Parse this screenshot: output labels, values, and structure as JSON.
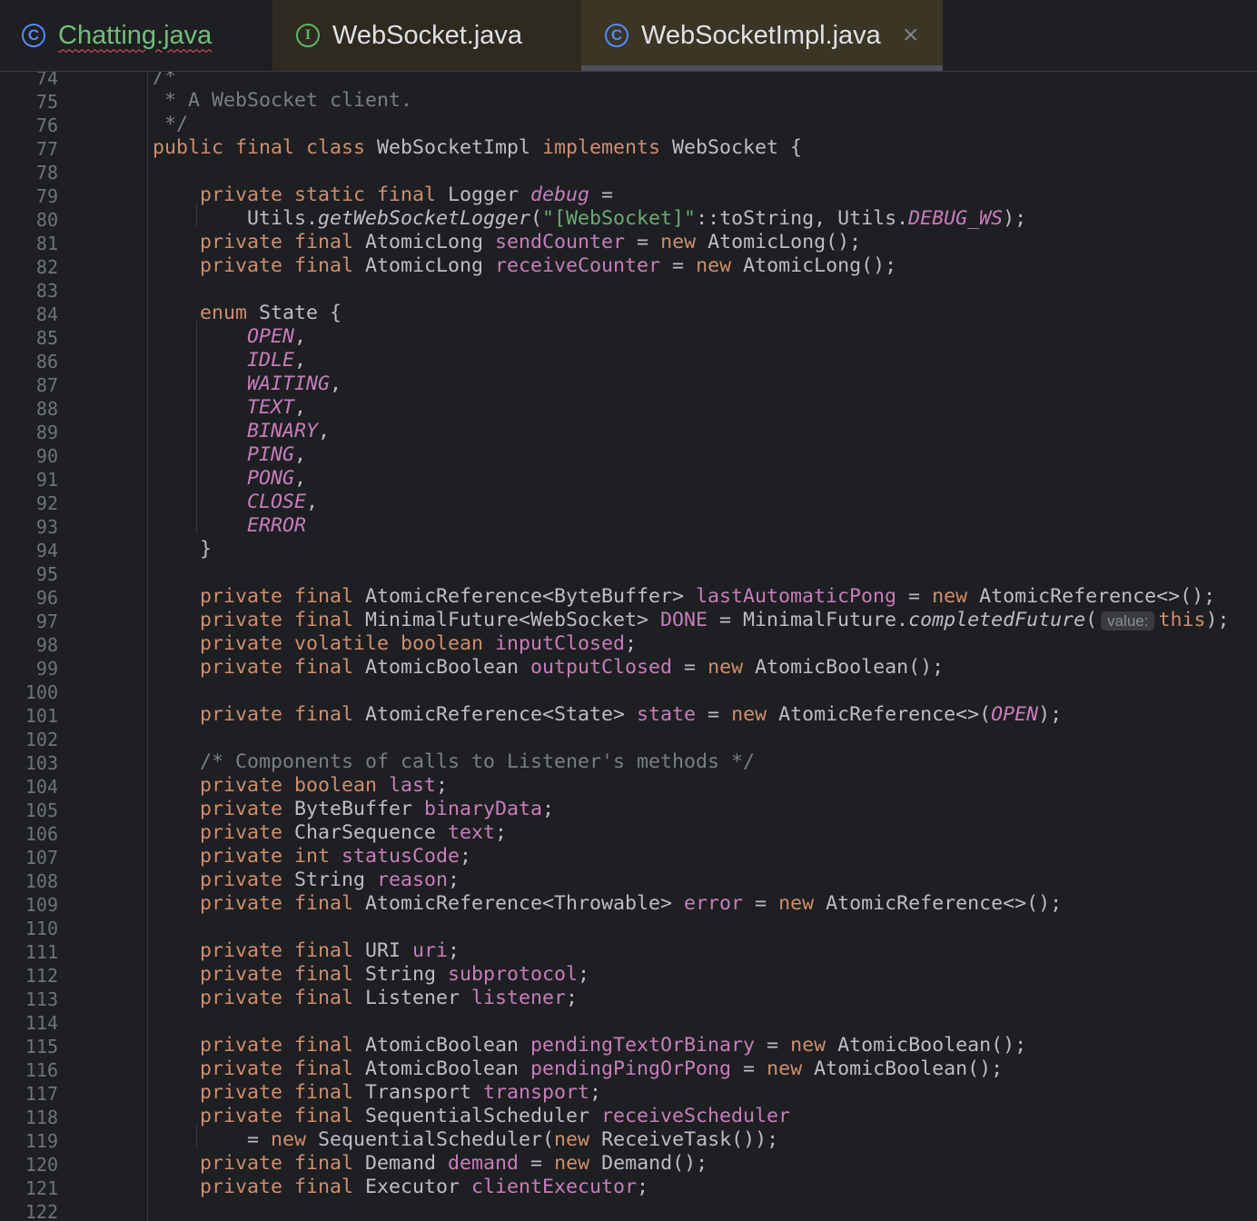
{
  "tabs": [
    {
      "label": "Chatting.java",
      "icon": "class-icon"
    },
    {
      "label": "WebSocket.java",
      "icon": "interface-icon"
    },
    {
      "label": "WebSocketImpl.java",
      "icon": "class-icon",
      "active": true,
      "close": "×"
    }
  ],
  "colors": {
    "background": "#1e1f22",
    "keyword": "#cf8e6d",
    "field": "#c77dbb",
    "string": "#6aab73",
    "comment": "#7a7e85",
    "text": "#bcbec4",
    "line_number": "#6f737a"
  },
  "editor": {
    "lines": [
      {
        "n": "74",
        "t": [
          [
            "/*",
            "cm"
          ]
        ]
      },
      {
        "n": "75",
        "t": [
          [
            " * A WebSocket client.",
            "cm"
          ]
        ]
      },
      {
        "n": "76",
        "t": [
          [
            " */",
            "cm"
          ]
        ]
      },
      {
        "n": "77",
        "t": [
          [
            "public final class ",
            "kw"
          ],
          [
            "WebSocketImpl ",
            ""
          ],
          [
            "implements ",
            "kw"
          ],
          [
            "WebSocket {",
            ""
          ]
        ]
      },
      {
        "n": "78",
        "t": []
      },
      {
        "n": "79",
        "t": [
          [
            "    private static final ",
            "kw"
          ],
          [
            "Logger ",
            ""
          ],
          [
            "debug",
            "st"
          ],
          [
            " =",
            ""
          ]
        ]
      },
      {
        "n": "80",
        "t": [
          [
            "        Utils.",
            ""
          ],
          [
            "getWebSocketLogger",
            "it"
          ],
          [
            "(",
            ""
          ],
          [
            "\"[WebSocket]\"",
            "str"
          ],
          [
            "::toString, Utils.",
            ""
          ],
          [
            "DEBUG_WS",
            "st"
          ],
          [
            ");",
            ""
          ]
        ]
      },
      {
        "n": "81",
        "t": [
          [
            "    private final ",
            "kw"
          ],
          [
            "AtomicLong ",
            ""
          ],
          [
            "sendCounter",
            "fld"
          ],
          [
            " = ",
            ""
          ],
          [
            "new ",
            "kw"
          ],
          [
            "AtomicLong();",
            ""
          ]
        ]
      },
      {
        "n": "82",
        "t": [
          [
            "    private final ",
            "kw"
          ],
          [
            "AtomicLong ",
            ""
          ],
          [
            "receiveCounter",
            "fld"
          ],
          [
            " = ",
            ""
          ],
          [
            "new ",
            "kw"
          ],
          [
            "AtomicLong();",
            ""
          ]
        ]
      },
      {
        "n": "83",
        "t": []
      },
      {
        "n": "84",
        "t": [
          [
            "    enum ",
            "kw"
          ],
          [
            "State {",
            ""
          ]
        ]
      },
      {
        "n": "85",
        "t": [
          [
            "        ",
            ""
          ],
          [
            "OPEN",
            "st"
          ],
          [
            ",",
            ""
          ]
        ]
      },
      {
        "n": "86",
        "t": [
          [
            "        ",
            ""
          ],
          [
            "IDLE",
            "st"
          ],
          [
            ",",
            ""
          ]
        ]
      },
      {
        "n": "87",
        "t": [
          [
            "        ",
            ""
          ],
          [
            "WAITING",
            "st"
          ],
          [
            ",",
            ""
          ]
        ]
      },
      {
        "n": "88",
        "t": [
          [
            "        ",
            ""
          ],
          [
            "TEXT",
            "st"
          ],
          [
            ",",
            ""
          ]
        ]
      },
      {
        "n": "89",
        "t": [
          [
            "        ",
            ""
          ],
          [
            "BINARY",
            "st"
          ],
          [
            ",",
            ""
          ]
        ]
      },
      {
        "n": "90",
        "t": [
          [
            "        ",
            ""
          ],
          [
            "PING",
            "st"
          ],
          [
            ",",
            ""
          ]
        ]
      },
      {
        "n": "91",
        "t": [
          [
            "        ",
            ""
          ],
          [
            "PONG",
            "st"
          ],
          [
            ",",
            ""
          ]
        ]
      },
      {
        "n": "92",
        "t": [
          [
            "        ",
            ""
          ],
          [
            "CLOSE",
            "st"
          ],
          [
            ",",
            ""
          ]
        ]
      },
      {
        "n": "93",
        "t": [
          [
            "        ",
            ""
          ],
          [
            "ERROR",
            "st"
          ]
        ]
      },
      {
        "n": "94",
        "t": [
          [
            "    }",
            ""
          ]
        ]
      },
      {
        "n": "95",
        "t": []
      },
      {
        "n": "96",
        "t": [
          [
            "    private final ",
            "kw"
          ],
          [
            "AtomicReference<ByteBuffer> ",
            ""
          ],
          [
            "lastAutomaticPong",
            "fld"
          ],
          [
            " = ",
            ""
          ],
          [
            "new ",
            "kw"
          ],
          [
            "AtomicReference<>();",
            ""
          ]
        ]
      },
      {
        "n": "97",
        "t": [
          [
            "    private final ",
            "kw"
          ],
          [
            "MinimalFuture<WebSocket> ",
            ""
          ],
          [
            "DONE",
            "fld"
          ],
          [
            " = MinimalFuture.",
            ""
          ],
          [
            "completedFuture",
            "it"
          ],
          [
            "(",
            ""
          ],
          [
            "value:",
            "hint"
          ],
          [
            "this",
            "kw"
          ],
          [
            ");",
            ""
          ]
        ]
      },
      {
        "n": "98",
        "t": [
          [
            "    private volatile boolean ",
            "kw"
          ],
          [
            "inputClosed",
            "fld"
          ],
          [
            ";",
            ""
          ]
        ]
      },
      {
        "n": "99",
        "t": [
          [
            "    private final ",
            "kw"
          ],
          [
            "AtomicBoolean ",
            ""
          ],
          [
            "outputClosed",
            "fld"
          ],
          [
            " = ",
            ""
          ],
          [
            "new ",
            "kw"
          ],
          [
            "AtomicBoolean();",
            ""
          ]
        ]
      },
      {
        "n": "100",
        "t": []
      },
      {
        "n": "101",
        "t": [
          [
            "    private final ",
            "kw"
          ],
          [
            "AtomicReference<State> ",
            ""
          ],
          [
            "state",
            "fld"
          ],
          [
            " = ",
            ""
          ],
          [
            "new ",
            "kw"
          ],
          [
            "AtomicReference<>(",
            ""
          ],
          [
            "OPEN",
            "st"
          ],
          [
            ");",
            ""
          ]
        ]
      },
      {
        "n": "102",
        "t": []
      },
      {
        "n": "103",
        "t": [
          [
            "    /* Components of calls to Listener's methods */",
            "cm"
          ]
        ]
      },
      {
        "n": "104",
        "t": [
          [
            "    private boolean ",
            "kw"
          ],
          [
            "last",
            "fld"
          ],
          [
            ";",
            ""
          ]
        ]
      },
      {
        "n": "105",
        "t": [
          [
            "    private ",
            "kw"
          ],
          [
            "ByteBuffer ",
            ""
          ],
          [
            "binaryData",
            "fld"
          ],
          [
            ";",
            ""
          ]
        ]
      },
      {
        "n": "106",
        "t": [
          [
            "    private ",
            "kw"
          ],
          [
            "CharSequence ",
            ""
          ],
          [
            "text",
            "fld"
          ],
          [
            ";",
            ""
          ]
        ]
      },
      {
        "n": "107",
        "t": [
          [
            "    private int ",
            "kw"
          ],
          [
            "statusCode",
            "fld"
          ],
          [
            ";",
            ""
          ]
        ]
      },
      {
        "n": "108",
        "t": [
          [
            "    private ",
            "kw"
          ],
          [
            "String ",
            ""
          ],
          [
            "reason",
            "fld"
          ],
          [
            ";",
            ""
          ]
        ]
      },
      {
        "n": "109",
        "t": [
          [
            "    private final ",
            "kw"
          ],
          [
            "AtomicReference<Throwable> ",
            ""
          ],
          [
            "error",
            "fld"
          ],
          [
            " = ",
            ""
          ],
          [
            "new ",
            "kw"
          ],
          [
            "AtomicReference<>();",
            ""
          ]
        ]
      },
      {
        "n": "110",
        "t": []
      },
      {
        "n": "111",
        "t": [
          [
            "    private final ",
            "kw"
          ],
          [
            "URI ",
            ""
          ],
          [
            "uri",
            "fld"
          ],
          [
            ";",
            ""
          ]
        ]
      },
      {
        "n": "112",
        "t": [
          [
            "    private final ",
            "kw"
          ],
          [
            "String ",
            ""
          ],
          [
            "subprotocol",
            "fld"
          ],
          [
            ";",
            ""
          ]
        ]
      },
      {
        "n": "113",
        "t": [
          [
            "    private final ",
            "kw"
          ],
          [
            "Listener ",
            ""
          ],
          [
            "listener",
            "fld"
          ],
          [
            ";",
            ""
          ]
        ]
      },
      {
        "n": "114",
        "t": []
      },
      {
        "n": "115",
        "t": [
          [
            "    private final ",
            "kw"
          ],
          [
            "AtomicBoolean ",
            ""
          ],
          [
            "pendingTextOrBinary",
            "fld"
          ],
          [
            " = ",
            ""
          ],
          [
            "new ",
            "kw"
          ],
          [
            "AtomicBoolean();",
            ""
          ]
        ]
      },
      {
        "n": "116",
        "t": [
          [
            "    private final ",
            "kw"
          ],
          [
            "AtomicBoolean ",
            ""
          ],
          [
            "pendingPingOrPong",
            "fld"
          ],
          [
            " = ",
            ""
          ],
          [
            "new ",
            "kw"
          ],
          [
            "AtomicBoolean();",
            ""
          ]
        ]
      },
      {
        "n": "117",
        "t": [
          [
            "    private final ",
            "kw"
          ],
          [
            "Transport ",
            ""
          ],
          [
            "transport",
            "fld"
          ],
          [
            ";",
            ""
          ]
        ]
      },
      {
        "n": "118",
        "t": [
          [
            "    private final ",
            "kw"
          ],
          [
            "SequentialScheduler ",
            ""
          ],
          [
            "receiveScheduler",
            "fld"
          ]
        ]
      },
      {
        "n": "119",
        "t": [
          [
            "        = ",
            ""
          ],
          [
            "new ",
            "kw"
          ],
          [
            "SequentialScheduler(",
            ""
          ],
          [
            "new ",
            "kw"
          ],
          [
            "ReceiveTask());",
            ""
          ]
        ]
      },
      {
        "n": "120",
        "t": [
          [
            "    private final ",
            "kw"
          ],
          [
            "Demand ",
            ""
          ],
          [
            "demand",
            "fld"
          ],
          [
            " = ",
            ""
          ],
          [
            "new ",
            "kw"
          ],
          [
            "Demand();",
            ""
          ]
        ]
      },
      {
        "n": "121",
        "t": [
          [
            "    private final ",
            "kw"
          ],
          [
            "Executor ",
            ""
          ],
          [
            "clientExecutor",
            "fld"
          ],
          [
            ";",
            ""
          ]
        ]
      },
      {
        "n": "122",
        "t": []
      }
    ]
  }
}
